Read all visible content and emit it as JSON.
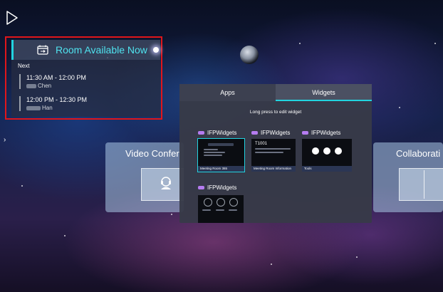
{
  "room_widget": {
    "title": "Room Available Now",
    "next_label": "Next",
    "bookings": [
      {
        "time": "11:30 AM - 12:00 PM",
        "who": "Chen"
      },
      {
        "time": "12:00 PM - 12:30 PM",
        "who": "Han"
      }
    ]
  },
  "background_cards": {
    "left_label": "Video Confer",
    "right_label": "Collaborati"
  },
  "panel": {
    "tabs": [
      "Apps",
      "Widgets"
    ],
    "active_tab": "Widgets",
    "hint": "Long press to edit widget",
    "groups": [
      {
        "name": "IFPWidgets",
        "widget_caption": "Meeting Room 365"
      },
      {
        "name": "IFPWidgets",
        "widget_caption": "Meeting Room Information"
      },
      {
        "name": "IFPWidgets",
        "widget_caption": "Tools"
      },
      {
        "name": "IFPWidgets",
        "widget_caption": ""
      }
    ]
  },
  "colors": {
    "accent": "#22d3e0",
    "highlight_border": "#e0161b",
    "panel_bg": "#373a48"
  },
  "icons": [
    "cursor-icon",
    "calendar-refresh-icon",
    "chevron-right-icon",
    "person-icon"
  ]
}
